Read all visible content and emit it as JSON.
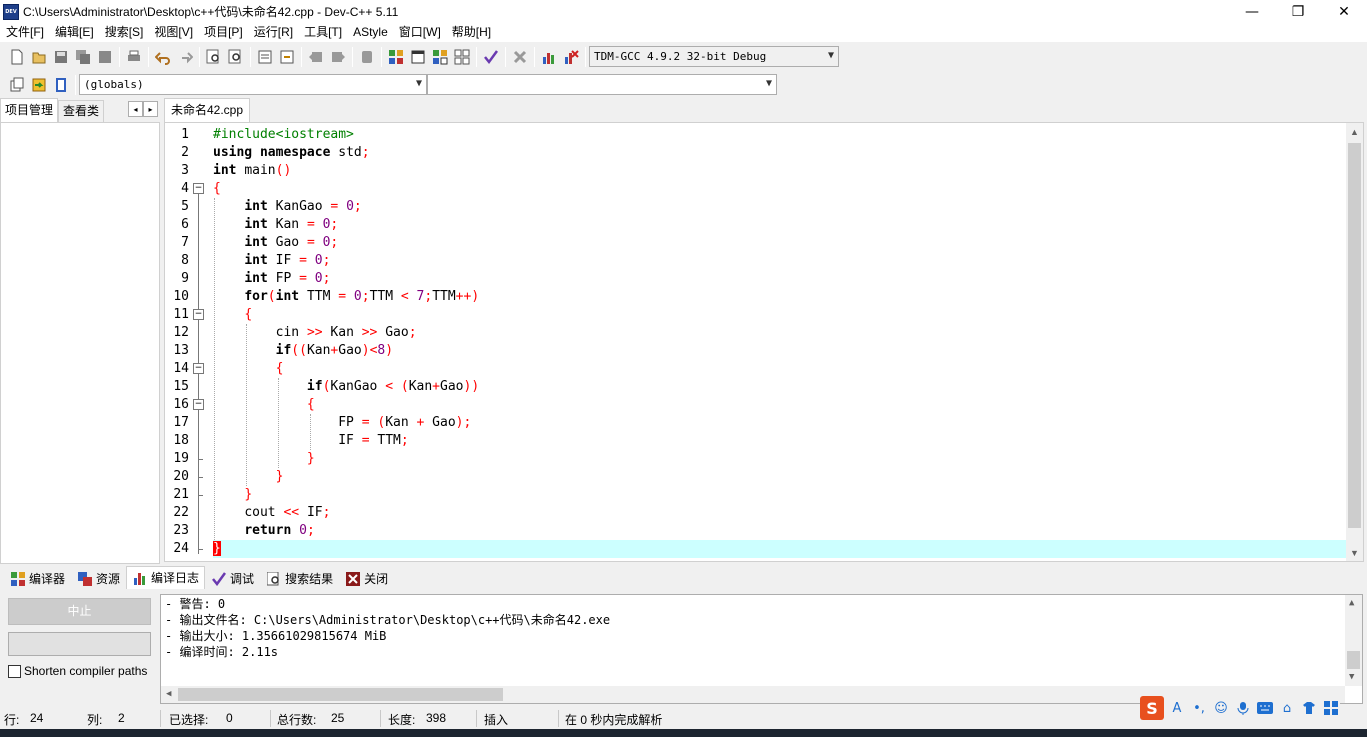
{
  "window": {
    "title": "C:\\Users\\Administrator\\Desktop\\c++代码\\未命名42.cpp - Dev-C++ 5.11",
    "icon_label": "DEV",
    "minimize": "—",
    "maximize": "❐",
    "close": "✕"
  },
  "menu": [
    "文件[F]",
    "编辑[E]",
    "搜索[S]",
    "视图[V]",
    "项目[P]",
    "运行[R]",
    "工具[T]",
    "AStyle",
    "窗口[W]",
    "帮助[H]"
  ],
  "toolbar": {
    "compiler_select": "TDM-GCC 4.9.2 32-bit Debug",
    "scope_select": "(globals)",
    "symbol_select": ""
  },
  "left_panel": {
    "tabs": [
      "项目管理",
      "查看类"
    ],
    "arrow_left": "◂",
    "arrow_right": "▸"
  },
  "editor": {
    "tab": "未命名42.cpp",
    "line_numbers": [
      "1",
      "2",
      "3",
      "4",
      "5",
      "6",
      "7",
      "8",
      "9",
      "10",
      "11",
      "12",
      "13",
      "14",
      "15",
      "16",
      "17",
      "18",
      "19",
      "20",
      "21",
      "22",
      "23",
      "24"
    ],
    "code_lines": [
      "#include<iostream>",
      "using namespace std;",
      "int main()",
      "{",
      "    int KanGao = 0;",
      "    int Kan = 0;",
      "    int Gao = 0;",
      "    int IF = 0;",
      "    int FP = 0;",
      "    for(int TTM = 0;TTM < 7;TTM++)",
      "    {",
      "        cin >> Kan >> Gao;",
      "        if((Kan+Gao)<8)",
      "        {",
      "            if(KanGao < (Kan+Gao))",
      "            {",
      "                FP = (Kan + Gao);",
      "                IF = TTM;",
      "            }",
      "        }",
      "    }",
      "    cout << IF;",
      "    return 0;",
      "}"
    ],
    "current_line": 24
  },
  "bottom_panel": {
    "tabs": [
      {
        "label": "编译器",
        "icon": "grid-icon"
      },
      {
        "label": "资源",
        "icon": "resource-icon"
      },
      {
        "label": "编译日志",
        "icon": "chart-icon"
      },
      {
        "label": "调试",
        "icon": "check-icon"
      },
      {
        "label": "搜索结果",
        "icon": "search-icon"
      },
      {
        "label": "关闭",
        "icon": "close-icon"
      }
    ],
    "stop_button": "中止",
    "shorten_paths": "Shorten compiler paths",
    "log_lines": [
      "- 警告: 0",
      "- 输出文件名: C:\\Users\\Administrator\\Desktop\\c++代码\\未命名42.exe",
      "- 输出大小: 1.35661029815674 MiB",
      "- 编译时间: 2.11s"
    ]
  },
  "status": {
    "line_label": "行:",
    "line_value": "24",
    "col_label": "列:",
    "col_value": "2",
    "sel_label": "已选择:",
    "sel_value": "0",
    "total_label": "总行数:",
    "total_value": "25",
    "len_label": "长度:",
    "len_value": "398",
    "mode": "插入",
    "parse": "在 0 秒内完成解析"
  },
  "ime": {
    "logo": "S"
  },
  "colors": {
    "keyword": "#000000",
    "preprocessor": "#008000",
    "symbol": "#ff0000",
    "number": "#800080",
    "active_line": "#ccffff"
  }
}
